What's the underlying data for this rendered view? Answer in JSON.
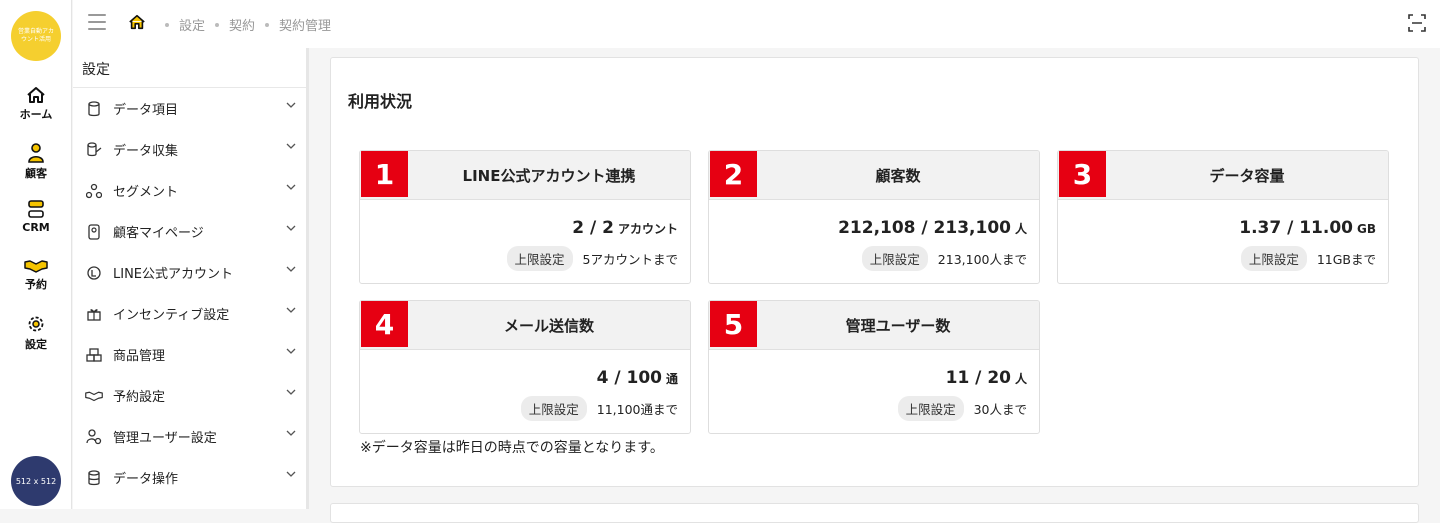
{
  "rail": {
    "logo_text": "営業自動アカウント活用",
    "items": [
      {
        "label": "ホーム",
        "icon": "home-icon"
      },
      {
        "label": "顧客",
        "icon": "person-icon"
      },
      {
        "label": "CRM",
        "icon": "crm-icon"
      },
      {
        "label": "予約",
        "icon": "handshake-icon"
      },
      {
        "label": "設定",
        "icon": "gear-icon"
      }
    ],
    "avatar_text": "512 x 512"
  },
  "breadcrumb": [
    "設定",
    "契約",
    "契約管理"
  ],
  "menu": {
    "title": "設定",
    "items": [
      {
        "label": "データ項目",
        "icon": "database-icon"
      },
      {
        "label": "データ収集",
        "icon": "collect-icon"
      },
      {
        "label": "セグメント",
        "icon": "segment-icon"
      },
      {
        "label": "顧客マイページ",
        "icon": "mypage-icon"
      },
      {
        "label": "LINE公式アカウント",
        "icon": "line-icon"
      },
      {
        "label": "インセンティブ設定",
        "icon": "gift-icon"
      },
      {
        "label": "商品管理",
        "icon": "boxes-icon"
      },
      {
        "label": "予約設定",
        "icon": "handshake-icon"
      },
      {
        "label": "管理ユーザー設定",
        "icon": "user-gear-icon"
      },
      {
        "label": "データ操作",
        "icon": "db-ops-icon"
      }
    ]
  },
  "main": {
    "title": "利用状況",
    "limit_label": "上限設定",
    "cards": [
      {
        "num": "1",
        "label": "LINE公式アカウント連携",
        "value": "2 / 2",
        "unit": "アカウント",
        "limit": "5アカウントまで"
      },
      {
        "num": "2",
        "label": "顧客数",
        "value": "212,108 / 213,100",
        "unit": "人",
        "limit": "213,100人まで"
      },
      {
        "num": "3",
        "label": "データ容量",
        "value": "1.37 / 11.00",
        "unit": "GB",
        "limit": "11GBまで"
      },
      {
        "num": "4",
        "label": "メール送信数",
        "value": "4 / 100",
        "unit": "通",
        "limit": "11,100通まで"
      },
      {
        "num": "5",
        "label": "管理ユーザー数",
        "value": "11 / 20",
        "unit": "人",
        "limit": "30人まで"
      }
    ],
    "note": "※データ容量は昨日の時点での容量となります。"
  }
}
